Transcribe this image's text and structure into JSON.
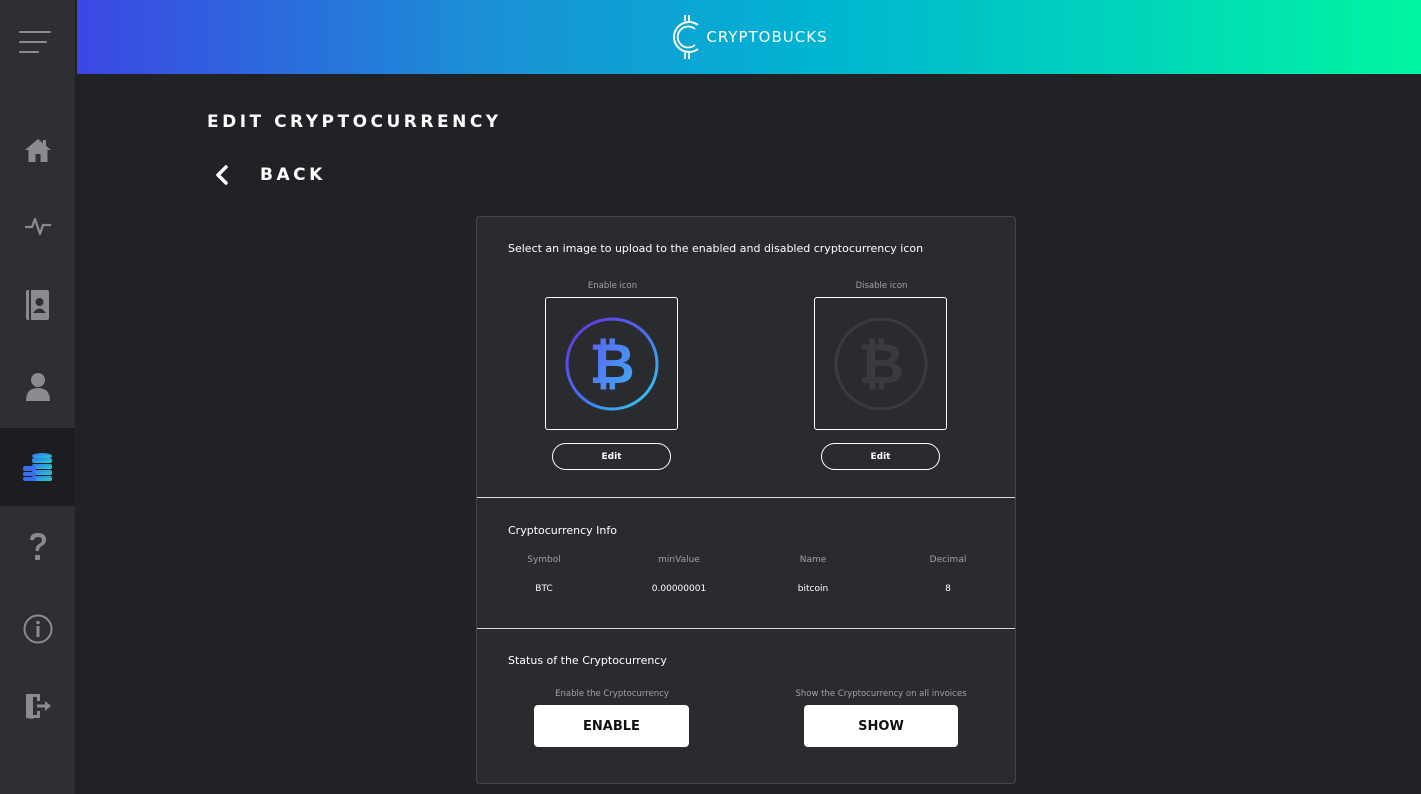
{
  "sidebar": {
    "items": [
      {
        "icon": "home-icon"
      },
      {
        "icon": "activity-icon"
      },
      {
        "icon": "contacts-icon"
      },
      {
        "icon": "user-icon"
      },
      {
        "icon": "coins-icon",
        "active": true
      },
      {
        "icon": "help-icon"
      },
      {
        "icon": "info-icon"
      },
      {
        "icon": "logout-icon"
      }
    ]
  },
  "header": {
    "logo_bold": "CRYPTO",
    "logo_light": "BUCKS"
  },
  "page": {
    "title": "EDIT CRYPTOCURRENCY",
    "back_label": "BACK"
  },
  "icons_section": {
    "title": "Select an image to upload to the enabled and disabled cryptocurrency icon",
    "enable_label": "Enable icon",
    "disable_label": "Disable icon",
    "edit_label": "Edit"
  },
  "info_section": {
    "title": "Cryptocurrency Info",
    "columns": [
      {
        "header": "Symbol",
        "value": "BTC"
      },
      {
        "header": "minValue",
        "value": "0.00000001"
      },
      {
        "header": "Name",
        "value": "bitcoin"
      },
      {
        "header": "Decimal",
        "value": "8"
      }
    ]
  },
  "status_section": {
    "title": "Status of the Cryptocurrency",
    "enable_caption": "Enable the Cryptocurrency",
    "enable_button": "ENABLE",
    "show_caption": "Show the Cryptocurrency on all invoices",
    "show_button": "SHOW"
  },
  "colors": {
    "gradient_start": "#3b47e3",
    "gradient_end": "#00f5a0",
    "sidebar": "#2e2f33",
    "background": "#212226",
    "card": "#2a2b2f"
  }
}
